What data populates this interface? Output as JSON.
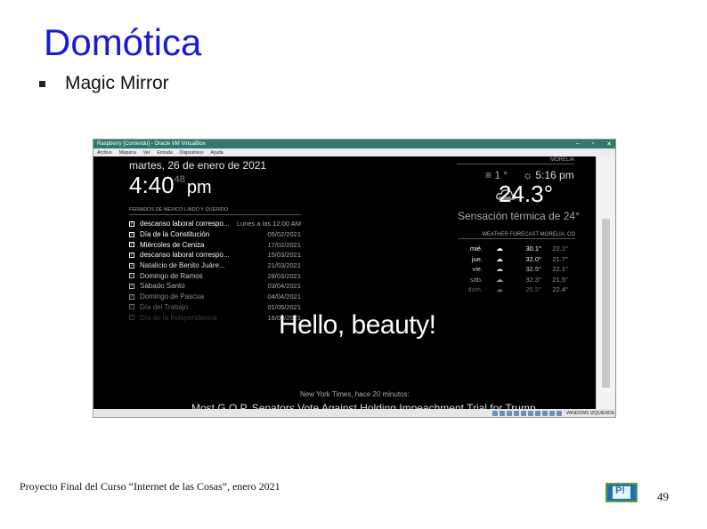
{
  "slide": {
    "title": "Domótica",
    "bullet": "Magic Mirror",
    "footer": "Proyecto Final del Curso “Internet de las Cosas”, enero 2021",
    "page_number": "49"
  },
  "vm": {
    "title": "Raspberry [Corriendo] - Oracle VM VirtualBox",
    "controls": [
      "–",
      "▫",
      "✕"
    ],
    "menu": [
      "Archivo",
      "Máquina",
      "Ver",
      "Entrada",
      "Dispositivos",
      "Ayuda"
    ],
    "status_label": "WINDOWS IZQUIERDA"
  },
  "mirror": {
    "date": "martes, 26 de enero de 2021",
    "time_hm": "4:40",
    "time_sec": "48",
    "time_ampm": "pm",
    "calendar_header": "FERIADOS DE MEXICO LINDO Y QUERIDO",
    "events": [
      {
        "title": "descanso laboral correspo...",
        "date": "Lunes a las 12:00 AM",
        "color": "#ffffff"
      },
      {
        "title": "Día de la Constitución",
        "date": "05/02/2021",
        "color": "#ffffff"
      },
      {
        "title": "Miércoles de Ceniza",
        "date": "17/02/2021",
        "color": "#ffffff"
      },
      {
        "title": "descanso laboral correspo...",
        "date": "15/03/2021",
        "color": "#f0f0f0"
      },
      {
        "title": "Natalicio de Benito Juáre...",
        "date": "21/03/2021",
        "color": "#dddddd"
      },
      {
        "title": "Domingo de Ramos",
        "date": "28/03/2021",
        "color": "#c8c8c8"
      },
      {
        "title": "Sábado Santo",
        "date": "03/04/2021",
        "color": "#b0b0b0"
      },
      {
        "title": "Domingo de Pascua",
        "date": "04/04/2021",
        "color": "#8a8a8a"
      },
      {
        "title": "Día del Trabajo",
        "date": "01/05/2021",
        "color": "#666666"
      },
      {
        "title": "Día de la Independencia",
        "date": "16/09/2021",
        "color": "#3a3a3a"
      }
    ],
    "weather_location": "MORELIA",
    "wind": "1",
    "sunset": "5:16 pm",
    "temperature": "24.3°",
    "feels_like": "Sensación térmica de 24°",
    "forecast_header": "WEATHER FORECAST MORELIA, CO",
    "forecast": [
      {
        "day": "mié.",
        "icon": "☁",
        "max": "30.1°",
        "min": "22.1°",
        "color": "#ffffff"
      },
      {
        "day": "jue.",
        "icon": "☁",
        "max": "32.0°",
        "min": "21.7°",
        "color": "#eeeeee"
      },
      {
        "day": "vie.",
        "icon": "☁",
        "max": "32.5°",
        "min": "22.1°",
        "color": "#cccccc"
      },
      {
        "day": "sáb.",
        "icon": "☁",
        "max": "32.3°",
        "min": "21.5°",
        "color": "#999999"
      },
      {
        "day": "dom.",
        "icon": "☁",
        "max": "25.5°",
        "min": "22.4°",
        "color": "#666666"
      }
    ],
    "greeting": "Hello, beauty!",
    "news_source": "New York Times, hace 20 minutos:",
    "news_headline": "Most G.O.P. Senators Vote Against Holding Impeachment Trial for Trump"
  },
  "colors": {
    "title": "#1a1ad6",
    "vm_titlebar": "#2f7a6a"
  }
}
